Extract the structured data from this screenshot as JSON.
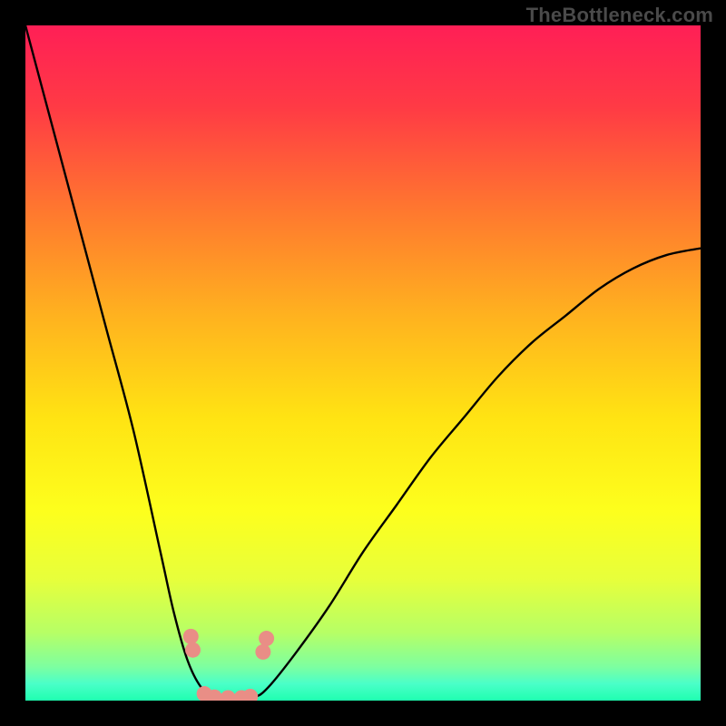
{
  "watermark": "TheBottleneck.com",
  "chart_data": {
    "type": "line",
    "note": "Bottleneck-style V-curve over a vertical rainbow gradient. No visible axes, ticks, or numeric labels. Values below are normalized [0,1] with x left→right and y as depicted plot height (1 = top, 0 = bottom). Curve values estimated from the image.",
    "x": [
      0.0,
      0.04,
      0.08,
      0.12,
      0.16,
      0.2,
      0.22,
      0.24,
      0.26,
      0.28,
      0.3,
      0.32,
      0.34,
      0.36,
      0.4,
      0.45,
      0.5,
      0.55,
      0.6,
      0.65,
      0.7,
      0.75,
      0.8,
      0.85,
      0.9,
      0.95,
      1.0
    ],
    "series": [
      {
        "name": "bottleneck-curve",
        "y": [
          1.0,
          0.85,
          0.7,
          0.55,
          0.4,
          0.22,
          0.13,
          0.06,
          0.02,
          0.005,
          0.003,
          0.003,
          0.005,
          0.02,
          0.07,
          0.14,
          0.22,
          0.29,
          0.36,
          0.42,
          0.48,
          0.53,
          0.57,
          0.61,
          0.64,
          0.66,
          0.67
        ],
        "color": "#000000"
      }
    ],
    "markers": {
      "comment": "Salmon dotted markers near the valley (approximate positions, normalized)",
      "color": "#e98e86",
      "points": [
        {
          "x": 0.245,
          "y": 0.095
        },
        {
          "x": 0.248,
          "y": 0.075
        },
        {
          "x": 0.265,
          "y": 0.01
        },
        {
          "x": 0.28,
          "y": 0.005
        },
        {
          "x": 0.3,
          "y": 0.004
        },
        {
          "x": 0.32,
          "y": 0.004
        },
        {
          "x": 0.333,
          "y": 0.006
        },
        {
          "x": 0.352,
          "y": 0.072
        },
        {
          "x": 0.357,
          "y": 0.092
        }
      ]
    },
    "background_gradient": {
      "direction": "top-to-bottom",
      "stops": [
        {
          "offset": 0.0,
          "color": "#ff1f56"
        },
        {
          "offset": 0.12,
          "color": "#ff3a45"
        },
        {
          "offset": 0.28,
          "color": "#ff7a2e"
        },
        {
          "offset": 0.43,
          "color": "#ffb21f"
        },
        {
          "offset": 0.58,
          "color": "#ffe313"
        },
        {
          "offset": 0.72,
          "color": "#fdff1d"
        },
        {
          "offset": 0.82,
          "color": "#e7ff3b"
        },
        {
          "offset": 0.9,
          "color": "#b6ff66"
        },
        {
          "offset": 0.95,
          "color": "#7dffa0"
        },
        {
          "offset": 0.975,
          "color": "#4affc8"
        },
        {
          "offset": 1.0,
          "color": "#1fffb0"
        }
      ]
    },
    "xlim": [
      0,
      1
    ],
    "ylim": [
      0,
      1
    ],
    "title": "",
    "xlabel": "",
    "ylabel": ""
  }
}
